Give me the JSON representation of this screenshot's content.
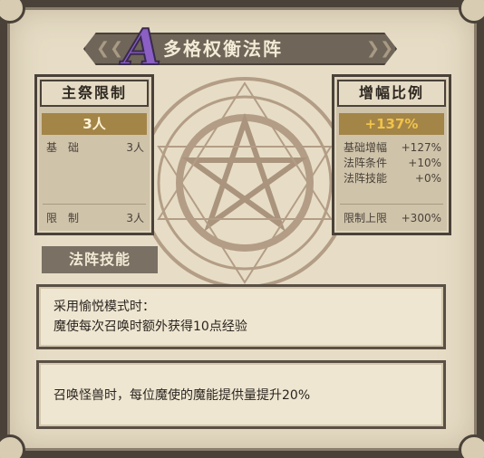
{
  "title": {
    "grade": "A",
    "name": "多格权衡法阵"
  },
  "left_panel": {
    "header": "主祭限制",
    "value": "3人",
    "rows": [
      {
        "label": "基　础",
        "value": "3人"
      },
      {
        "label": "限　制",
        "value": "3人"
      }
    ]
  },
  "right_panel": {
    "header": "增幅比例",
    "value": "+137%",
    "rows": [
      {
        "label": "基础增幅",
        "value": "+127%"
      },
      {
        "label": "法阵条件",
        "value": "+10%"
      },
      {
        "label": "法阵技能",
        "value": "+0%"
      },
      {
        "label": "限制上限",
        "value": "+300%"
      }
    ]
  },
  "skills": {
    "label": "法阵技能",
    "entries": [
      {
        "line1": "采用愉悦模式时：",
        "line2": "魔使每次召唤时额外获得10点经验"
      },
      {
        "line1": "召唤怪兽时，每位魔使的魔能提供量提升20%"
      }
    ]
  },
  "colors": {
    "accent_gold": "#a48548",
    "value_text_right": "#f0c34a",
    "grade_purple": "#8b5fc4"
  }
}
